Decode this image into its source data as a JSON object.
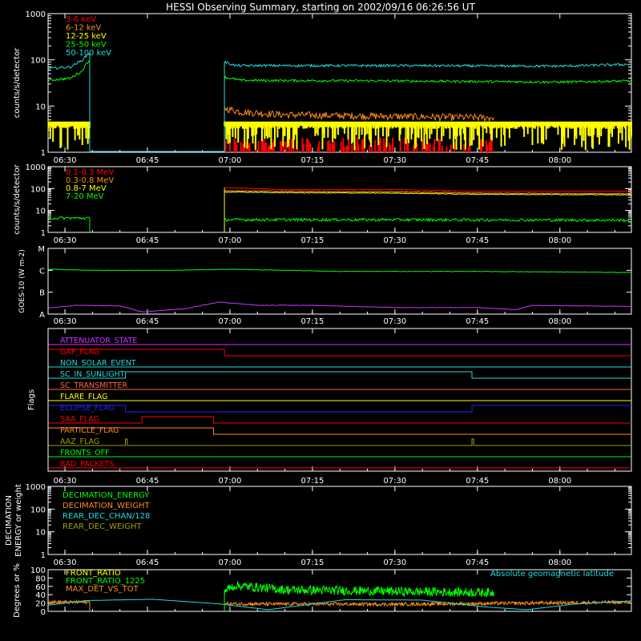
{
  "title": "HESSI Observing Summary, starting on 2002/09/16 06:26:56 UT",
  "colors": {
    "background": "#000000",
    "axes": "#ffffff",
    "red": "#ff0000",
    "orange": "#ff8c1a",
    "yellow": "#ffff00",
    "green": "#00ff00",
    "cyan": "#22dddd",
    "magenta": "#cc33ff",
    "blue": "#2222ff",
    "olive": "#a0a000",
    "salmon": "#ff6644"
  },
  "x_axis": {
    "start_time": "06:26:56",
    "end_time": "08:13",
    "ticks": [
      "06:30",
      "06:45",
      "07:00",
      "07:15",
      "07:30",
      "07:45",
      "08:00"
    ]
  },
  "chart_data": [
    {
      "type": "line",
      "panel": "lo-energy",
      "ylabel": "counts/s/detector",
      "yscale": "log",
      "ylim": [
        1,
        1000
      ],
      "yticks": [
        "1",
        "10",
        "100",
        "1000"
      ],
      "series": [
        {
          "name": "3-6 keV",
          "color": "red",
          "segments": [
            {
              "x": [
                "06:59:00",
                "07:48:00"
              ],
              "y": [
                1,
                1
              ],
              "note": "intermittent"
            }
          ]
        },
        {
          "name": "6-12 keV",
          "color": "orange",
          "segments": [
            {
              "x": [
                "06:59:00",
                "07:02:00",
                "07:10:00",
                "07:30:00",
                "07:48:00"
              ],
              "y": [
                9,
                7.5,
                6.5,
                6,
                5.6
              ]
            }
          ]
        },
        {
          "name": "12-25 keV",
          "color": "yellow",
          "segments": [
            {
              "x": [
                "06:27:00",
                "06:34:30"
              ],
              "y": [
                4,
                4
              ]
            },
            {
              "x": [
                "06:59:00",
                "08:13:00"
              ],
              "y": [
                4,
                4
              ]
            }
          ]
        },
        {
          "name": "25-50 keV",
          "color": "green",
          "segments": [
            {
              "x": [
                "06:27:00",
                "06:31:00",
                "06:33:00",
                "06:34:30"
              ],
              "y": [
                36,
                40,
                55,
                100
              ]
            },
            {
              "x": [
                "06:59:00",
                "07:02:00",
                "07:30:00",
                "08:00:00",
                "08:13:00"
              ],
              "y": [
                42,
                36,
                35,
                33,
                35
              ]
            }
          ]
        },
        {
          "name": "50-100 keV",
          "color": "cyan",
          "segments": [
            {
              "x": [
                "06:27:00",
                "06:31:00",
                "06:33:00",
                "06:34:30"
              ],
              "y": [
                65,
                70,
                95,
                140
              ]
            },
            {
              "x": [
                "06:59:00",
                "07:01:00",
                "07:30:00",
                "08:00:00",
                "08:13:00"
              ],
              "y": [
                90,
                75,
                75,
                73,
                80
              ]
            }
          ]
        }
      ]
    },
    {
      "type": "line",
      "panel": "hi-energy",
      "ylabel": "counts/s/detector",
      "yscale": "log",
      "ylim": [
        1,
        1000
      ],
      "yticks": [
        "1",
        "10",
        "100",
        "1000"
      ],
      "series": [
        {
          "name": "0.1-0.3 MeV",
          "color": "red",
          "segments": [
            {
              "x": [
                "06:59:00",
                "07:10:00",
                "07:30:00",
                "07:45:00",
                "08:13:00"
              ],
              "y": [
                110,
                90,
                90,
                75,
                75
              ]
            }
          ]
        },
        {
          "name": "0.3-0.8 MeV",
          "color": "orange",
          "segments": [
            {
              "x": [
                "06:59:00",
                "07:10:00",
                "07:30:00",
                "07:45:00",
                "08:13:00"
              ],
              "y": [
                80,
                75,
                72,
                62,
                58
              ]
            }
          ]
        },
        {
          "name": "0.8-7 MeV",
          "color": "yellow",
          "segments": [
            {
              "x": [
                "06:59:00",
                "07:10:00",
                "07:30:00",
                "07:45:00",
                "08:13:00"
              ],
              "y": [
                70,
                65,
                62,
                55,
                52
              ]
            }
          ]
        },
        {
          "name": "7-20 MeV",
          "color": "green",
          "segments": [
            {
              "x": [
                "06:27:00",
                "06:34:30"
              ],
              "y": [
                4.5,
                4.5
              ]
            },
            {
              "x": [
                "06:59:00",
                "07:30:00",
                "08:13:00"
              ],
              "y": [
                3.8,
                3.8,
                3.6
              ]
            }
          ]
        }
      ]
    },
    {
      "type": "line",
      "panel": "goes",
      "ylabel": "GOES-10 (W m-2)",
      "yticks": [
        "A",
        "B",
        "C",
        "M"
      ],
      "ylim": [
        0,
        3
      ],
      "series": [
        {
          "name": "GOES long",
          "color": "green",
          "x": [
            "06:27:00",
            "06:35:00",
            "06:50:00",
            "07:00:00",
            "07:20:00",
            "07:45:00",
            "08:13:00"
          ],
          "y": [
            2.05,
            2.0,
            2.0,
            2.05,
            1.95,
            1.95,
            1.9
          ]
        },
        {
          "name": "GOES short",
          "color": "magenta",
          "x": [
            "06:27:00",
            "06:32:00",
            "06:40:00",
            "06:44:00",
            "06:52:00",
            "06:58:00",
            "07:05:00",
            "07:15:00",
            "07:30:00",
            "07:45:00",
            "07:52:00",
            "07:55:00",
            "08:13:00"
          ],
          "y": [
            0.28,
            0.4,
            0.38,
            0.1,
            0.25,
            0.55,
            0.4,
            0.4,
            0.3,
            0.3,
            0.2,
            0.4,
            0.35
          ]
        }
      ]
    },
    {
      "type": "line",
      "panel": "flags",
      "ylabel": "Flags",
      "series": [
        {
          "name": "ATTENUATOR_STATE",
          "color": "magenta",
          "x": [
            "06:27:00",
            "08:13:00"
          ],
          "y": [
            0,
            0
          ]
        },
        {
          "name": "GAP_FLAG",
          "color": "red",
          "x": [
            "06:27:00",
            "06:59:00",
            "06:59:00",
            "08:13:00"
          ],
          "y": [
            1,
            1,
            0,
            0
          ]
        },
        {
          "name": "NON_SOLAR_EVENT",
          "color": "cyan",
          "x": [
            "06:27:00",
            "08:13:00"
          ],
          "y": [
            0,
            0
          ]
        },
        {
          "name": "SC_IN_SUNLIGHT",
          "color": "cyan",
          "x": [
            "06:27:00",
            "06:41:00",
            "06:41:00",
            "07:44:00",
            "07:44:00",
            "08:13:00"
          ],
          "y": [
            0,
            0,
            1,
            1,
            0,
            0
          ]
        },
        {
          "name": "SC_TRANSMITTER",
          "color": "salmon",
          "x": [
            "06:27:00",
            "08:13:00"
          ],
          "y": [
            0,
            0
          ]
        },
        {
          "name": "FLARE_FLAG",
          "color": "yellow",
          "x": [
            "06:27:00",
            "08:13:00"
          ],
          "y": [
            0,
            0
          ]
        },
        {
          "name": "ECLIPSE_FLAG",
          "color": "blue",
          "x": [
            "06:27:00",
            "06:41:00",
            "06:41:00",
            "07:44:00",
            "07:44:00",
            "08:13:00"
          ],
          "y": [
            1,
            1,
            0,
            0,
            1,
            1
          ]
        },
        {
          "name": "SAA_FLAG",
          "color": "red",
          "x": [
            "06:27:00",
            "06:44:00",
            "06:44:00",
            "06:57:00",
            "06:57:00",
            "08:13:00"
          ],
          "y": [
            0,
            0,
            1,
            1,
            0,
            0
          ]
        },
        {
          "name": "PARTICLE_FLAG",
          "color": "orange",
          "x": [
            "06:27:00",
            "06:57:00",
            "06:57:00",
            "08:13:00"
          ],
          "y": [
            1,
            1,
            0,
            0
          ]
        },
        {
          "name": "AAZ_FLAG",
          "color": "olive",
          "x": [
            "06:27:00",
            "06:41:00",
            "06:41:00",
            "06:41:20",
            "06:41:20",
            "07:44:00",
            "07:44:00",
            "07:44:20",
            "07:44:20",
            "08:13:00"
          ],
          "y": [
            0,
            0,
            1,
            1,
            0,
            0,
            1,
            1,
            0,
            0
          ]
        },
        {
          "name": "FRONTS_OFF",
          "color": "green",
          "x": [
            "06:27:00",
            "08:13:00"
          ],
          "y": [
            0,
            0
          ]
        },
        {
          "name": "BAD_PACKETS",
          "color": "red",
          "x": [
            "06:27:00",
            "08:13:00"
          ],
          "y": [
            0,
            0
          ]
        }
      ]
    },
    {
      "type": "line",
      "panel": "decimation",
      "ylabel": "DECIMATION ENERGY or weight",
      "yscale": "log",
      "ylim": [
        1,
        1000
      ],
      "yticks": [
        "1",
        "10",
        "100",
        "1000"
      ],
      "series": [
        {
          "name": "DECIMATION_ENERGY",
          "color": "green"
        },
        {
          "name": "DECIMATION_WEIGHT",
          "color": "orange"
        },
        {
          "name": "REAR_DEC_CHAN/128",
          "color": "cyan"
        },
        {
          "name": "REAR_DEC_WEIGHT",
          "color": "olive"
        }
      ]
    },
    {
      "type": "line",
      "panel": "ratios",
      "ylabel": "Degrees or %",
      "ylim": [
        0,
        100
      ],
      "yticks": [
        "0",
        "20",
        "40",
        "60",
        "80",
        "100"
      ],
      "annotation": "Absolute geomagnetic latitude",
      "series": [
        {
          "name": "FRONT_RATIO",
          "color": "yellow"
        },
        {
          "name": "FRONT_RATIO_1225",
          "color": "green",
          "segments": [
            {
              "x": [
                "06:59:00",
                "07:01:00",
                "07:10:00",
                "07:30:00",
                "07:48:00"
              ],
              "y": [
                50,
                62,
                52,
                48,
                45
              ]
            }
          ]
        },
        {
          "name": "MAX_DET_VS_TOT",
          "color": "orange",
          "segments": [
            {
              "x": [
                "06:27:00",
                "06:34:30"
              ],
              "y": [
                22,
                22
              ]
            },
            {
              "x": [
                "06:59:00",
                "07:30:00",
                "08:13:00"
              ],
              "y": [
                18,
                17,
                22
              ]
            }
          ]
        },
        {
          "name": "Absolute geomagnetic latitude",
          "color": "cyan",
          "x": [
            "06:27:00",
            "06:34:00",
            "06:46:00",
            "06:58:00",
            "07:07:00",
            "07:21:00",
            "07:35:00",
            "07:47:00",
            "07:54:00",
            "08:03:00",
            "08:13:00"
          ],
          "y": [
            15,
            26,
            29,
            18,
            4,
            28,
            27,
            10,
            4,
            18,
            25
          ]
        }
      ]
    }
  ]
}
